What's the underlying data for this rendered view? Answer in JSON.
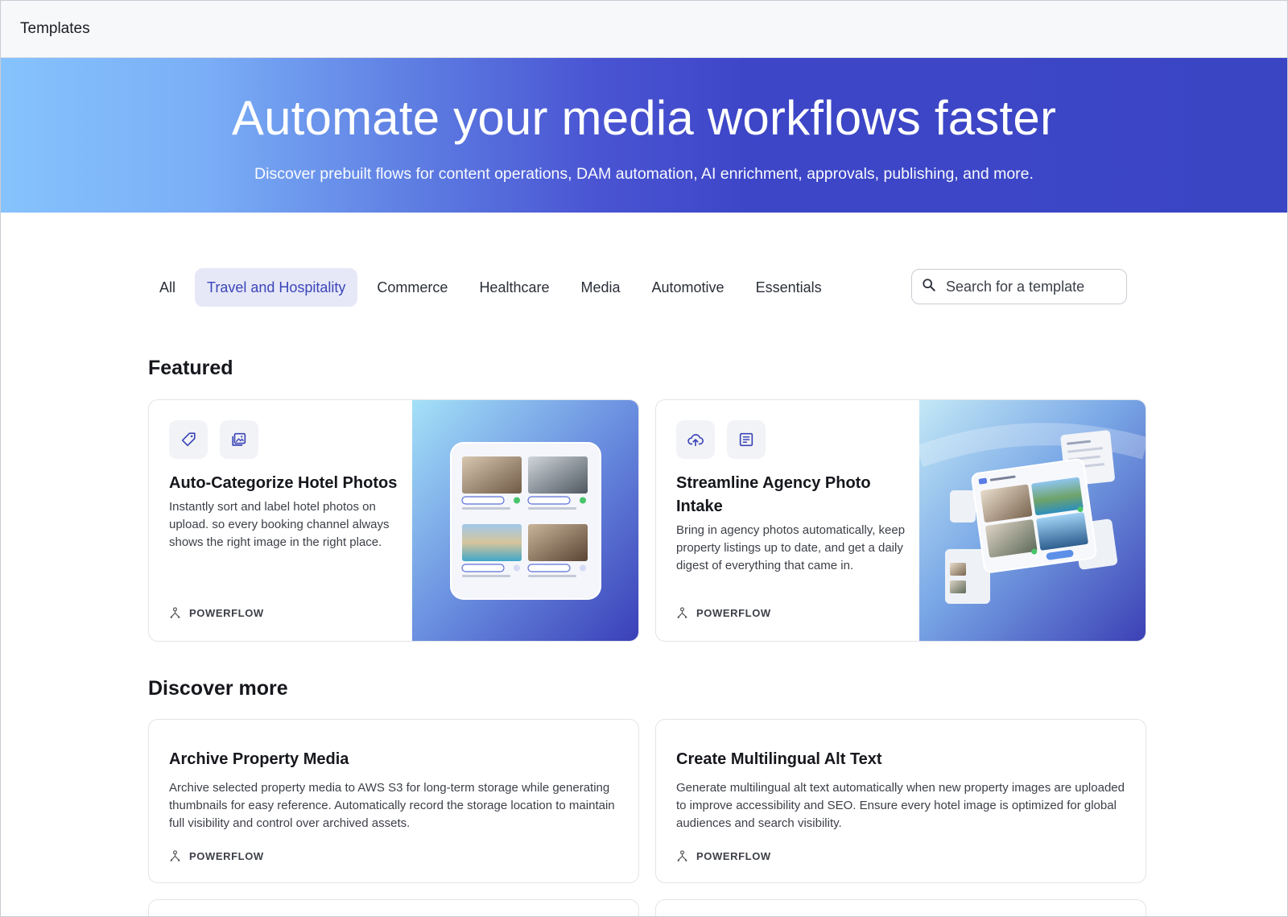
{
  "topbar": {
    "title": "Templates"
  },
  "hero": {
    "heading": "Automate your media workflows faster",
    "subheading": "Discover prebuilt flows for content operations, DAM automation, AI enrichment, approvals, publishing, and more."
  },
  "tabs": [
    {
      "label": "All",
      "active": false
    },
    {
      "label": "Travel and Hospitality",
      "active": true
    },
    {
      "label": "Commerce",
      "active": false
    },
    {
      "label": "Healthcare",
      "active": false
    },
    {
      "label": "Media",
      "active": false
    },
    {
      "label": "Automotive",
      "active": false
    },
    {
      "label": "Essentials",
      "active": false
    }
  ],
  "search": {
    "placeholder": "Search for a template",
    "icon": "search-icon"
  },
  "featured": {
    "title": "Featured",
    "cards": [
      {
        "title": "Auto-Categorize Hotel Photos",
        "description": "Instantly sort and label hotel photos on upload. so every booking channel always shows the right image in the right place.",
        "tag": "POWERFLOW",
        "icons": [
          "tag-icon",
          "image-gallery-icon"
        ]
      },
      {
        "title": "Streamline Agency Photo Intake",
        "description": "Bring in agency photos automatically, keep property listings up to date, and get a daily digest of everything that came in.",
        "tag": "POWERFLOW",
        "icons": [
          "cloud-upload-icon",
          "document-icon"
        ]
      }
    ]
  },
  "discover": {
    "title": "Discover more",
    "cards": [
      {
        "title": "Archive Property Media",
        "description": "Archive selected property media to AWS S3 for long-term storage while generating thumbnails for easy reference. Automatically record the storage location to maintain full visibility and control over archived assets.",
        "tag": "POWERFLOW"
      },
      {
        "title": "Create Multilingual Alt Text",
        "description": "Generate multilingual alt text automatically when new property images are uploaded to improve accessibility and SEO. Ensure every hotel image is optimized for global audiences and search visibility.",
        "tag": "POWERFLOW"
      }
    ]
  },
  "colors": {
    "accent": "#3b45b8",
    "hero_start": "#86c3fd",
    "hero_end": "#3a45c4",
    "active_tab_bg": "#e6e8f8"
  }
}
